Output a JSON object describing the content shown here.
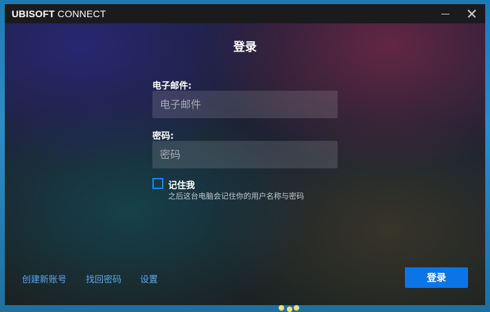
{
  "window": {
    "app_title_bold": "UBISOFT",
    "app_title_rest": " CONNECT"
  },
  "login": {
    "title": "登录",
    "email_label": "电子邮件:",
    "email_placeholder": "电子邮件",
    "email_value": "",
    "password_label": "密码:",
    "password_placeholder": "密码",
    "password_value": "",
    "remember_label": "记住我",
    "remember_hint": "之后这台电脑会记住你的用户名称与密码",
    "remember_checked": false,
    "submit_label": "登录"
  },
  "footer": {
    "create_account": "创建新账号",
    "recover_password": "找回密码",
    "settings": "设置"
  },
  "colors": {
    "accent": "#0b74e6",
    "link": "#5aa8ef",
    "titlebar": "#1b1b1e"
  },
  "icons": {
    "minimize": "minimize-icon",
    "close": "close-icon"
  }
}
